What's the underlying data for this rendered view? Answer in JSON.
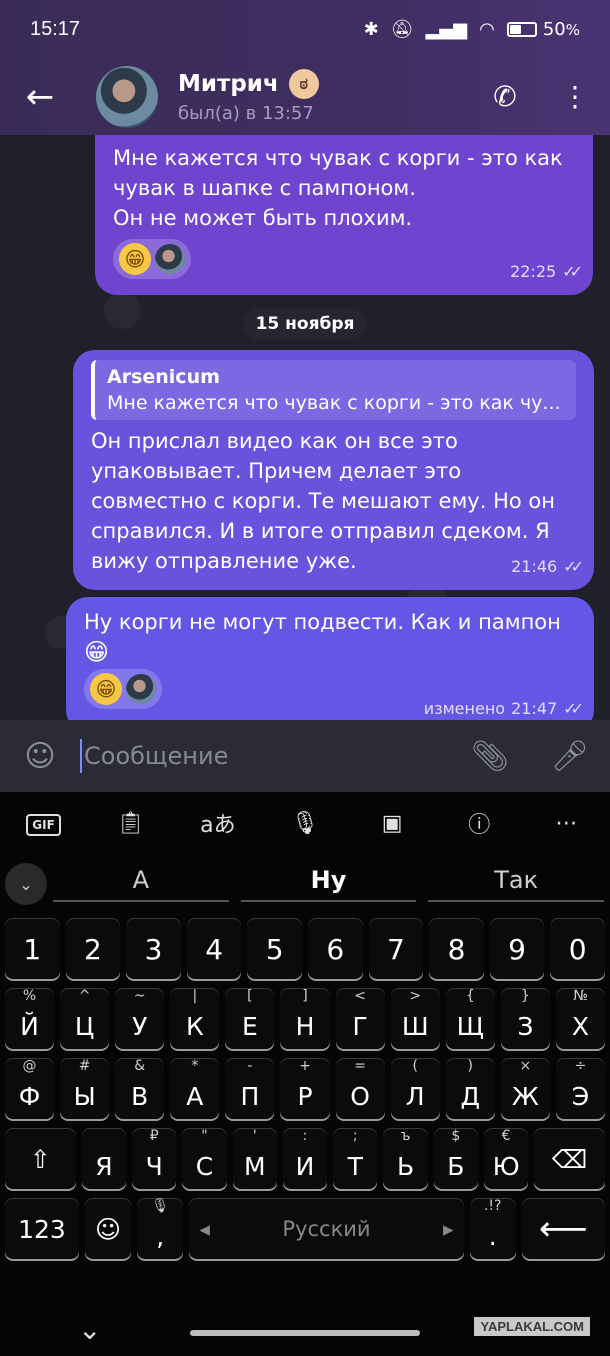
{
  "status_bar": {
    "time": "15:17",
    "icons": [
      "bluetooth-icon",
      "mute-icon",
      "signal-icon",
      "wifi-icon",
      "battery-icon"
    ],
    "battery_percent": "50",
    "battery_suffix": "%",
    "battery_level": 0.5
  },
  "header": {
    "contact_name": "Митрич",
    "last_seen": "был(а) в 13:57"
  },
  "messages": [
    {
      "text_lines": [
        "Мне кажется что чувак с корги - это как",
        "чувак в шапке с пампоном.",
        "Он не может быть плохим."
      ],
      "time": "22:25"
    },
    {
      "reply_author": "Arsenicum",
      "reply_text": "Мне кажется что чувак с корги - это как чу...",
      "text_lines": [
        "Он прислал видео как он все это",
        "упаковывает. Причем делает это",
        "совместно с корги. Те мешают ему. Но он",
        "справился. И в итоге отправил сдеком. Я",
        "вижу отправление уже."
      ],
      "time": "21:46"
    },
    {
      "text_lines": [
        "Ну корги не могут подвести. Как и пампон"
      ],
      "edited_label": "изменено",
      "time": "21:47"
    }
  ],
  "date_separator": "15 ноября",
  "input": {
    "placeholder": "Сообщение"
  },
  "keyboard": {
    "suggestions": [
      "А",
      "Ну",
      "Так"
    ],
    "number_row": [
      "1",
      "2",
      "3",
      "4",
      "5",
      "6",
      "7",
      "8",
      "9",
      "0"
    ],
    "row1": {
      "hints": [
        "%",
        "^",
        "~",
        "|",
        "[",
        "]",
        "<",
        ">",
        "{",
        "}",
        "№"
      ],
      "keys": [
        "Й",
        "Ц",
        "У",
        "К",
        "Е",
        "Н",
        "Г",
        "Ш",
        "Щ",
        "З",
        "Х"
      ]
    },
    "row2": {
      "hints": [
        "@",
        "#",
        "&",
        "*",
        "-",
        "+",
        "=",
        "(",
        ")",
        "×",
        "÷"
      ],
      "keys": [
        "Ф",
        "Ы",
        "В",
        "А",
        "П",
        "Р",
        "О",
        "Л",
        "Д",
        "Ж",
        "Э"
      ]
    },
    "row3": {
      "hints": [
        "₽",
        "\"",
        "'",
        ":",
        ";",
        "ъ",
        "$",
        "€"
      ],
      "keys": [
        "Я",
        "Ч",
        "С",
        "М",
        "И",
        "Т",
        "Ь",
        "Б",
        "Ю"
      ]
    },
    "bottom": {
      "symbols": "123",
      "comma": ",",
      "space_label": "Русский",
      "period": ".",
      "period_hint": ".!?"
    }
  },
  "watermark": "YAPLAKAL.COM"
}
